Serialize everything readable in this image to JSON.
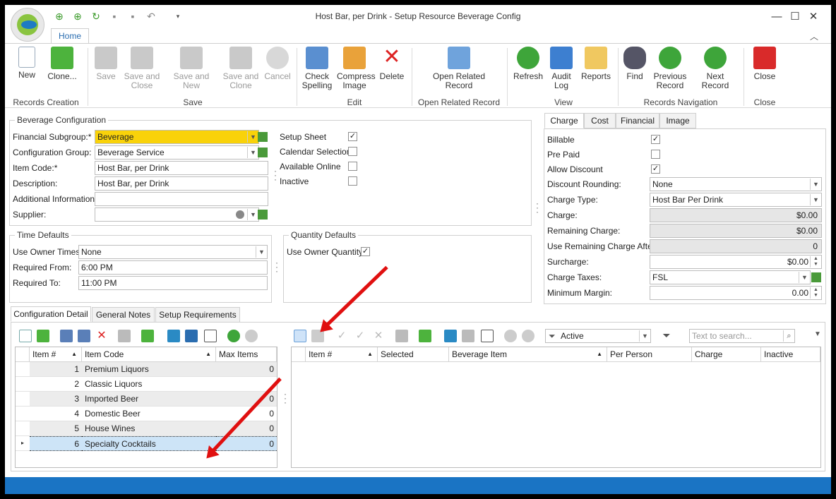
{
  "window": {
    "title": "Host Bar, per Drink - Setup Resource Beverage Config",
    "tab": "Home",
    "min": "—",
    "max": "☐",
    "close": "✕",
    "collapse": "︿"
  },
  "ribbon": {
    "new": "New",
    "clone": "Clone...",
    "save": "Save",
    "save_close_1": "Save and",
    "save_close_2": "Close",
    "save_new": "Save and New",
    "save_clone_1": "Save and",
    "save_clone_2": "Clone",
    "cancel": "Cancel",
    "check_1": "Check",
    "check_2": "Spelling",
    "compress_1": "Compress",
    "compress_2": "Image",
    "delete": "Delete",
    "orr_1": "Open Related",
    "orr_2": "Record",
    "refresh": "Refresh",
    "audit_1": "Audit",
    "audit_2": "Log",
    "reports": "Reports",
    "find": "Find",
    "prev_1": "Previous",
    "prev_2": "Record",
    "next": "Next Record",
    "close": "Close",
    "groups": {
      "records_creation": "Records Creation",
      "save": "Save",
      "edit": "Edit",
      "open_related": "Open Related Record",
      "view": "View",
      "nav": "Records Navigation",
      "close": "Close"
    }
  },
  "bev": {
    "title": "Beverage Configuration",
    "financial_subgroup_label": "Financial Subgroup:*",
    "financial_subgroup": "Beverage",
    "config_group_label": "Configuration Group:",
    "config_group": "Beverage Service",
    "item_code_label": "Item Code:*",
    "item_code": "Host Bar, per Drink",
    "description_label": "Description:",
    "description": "Host Bar, per Drink",
    "additional_label": "Additional Information:",
    "additional": "",
    "supplier_label": "Supplier:",
    "supplier": "",
    "setup_sheet": "Setup Sheet",
    "calendar": "Calendar Selection",
    "online": "Available Online",
    "inactive": "Inactive"
  },
  "time": {
    "title": "Time Defaults",
    "owner_label": "Use Owner Times:",
    "owner": "None",
    "from_label": "Required From:",
    "from": "6:00 PM",
    "to_label": "Required To:",
    "to": "11:00 PM"
  },
  "qty": {
    "title": "Quantity Defaults",
    "owner_qty": "Use Owner Quantity"
  },
  "charge_tabs": [
    "Charge",
    "Cost",
    "Financial",
    "Image"
  ],
  "charge": {
    "billable": "Billable",
    "prepaid": "Pre Paid",
    "allow_discount": "Allow Discount",
    "rounding_label": "Discount Rounding:",
    "rounding": "None",
    "type_label": "Charge Type:",
    "type": "Host Bar Per Drink",
    "charge_label": "Charge:",
    "charge": "$0.00",
    "remaining_label": "Remaining Charge:",
    "remaining": "$0.00",
    "after_label": "Use Remaining Charge After:",
    "after": "0",
    "surcharge_label": "Surcharge:",
    "surcharge": "$0.00",
    "taxes_label": "Charge Taxes:",
    "taxes": "FSL",
    "margin_label": "Minimum Margin:",
    "margin": "0.00"
  },
  "detail_tabs": [
    "Configuration Detail",
    "General Notes",
    "Setup Requirements"
  ],
  "left_grid": {
    "headers": [
      "Item #",
      "Item Code",
      "Max Items"
    ],
    "rows": [
      [
        "1",
        "Premium Liquors",
        "0"
      ],
      [
        "2",
        "Classic Liquors",
        ""
      ],
      [
        "3",
        "Imported Beer",
        "0"
      ],
      [
        "4",
        "Domestic Beer",
        "0"
      ],
      [
        "5",
        "House Wines",
        "0"
      ],
      [
        "6",
        "Specialty Cocktails",
        "0"
      ]
    ]
  },
  "right_grid": {
    "headers": [
      "Item #",
      "Selected",
      "Beverage Item",
      "Per Person",
      "Charge",
      "Inactive"
    ]
  },
  "filter": {
    "active": "Active",
    "search_placeholder": "Text to search..."
  }
}
